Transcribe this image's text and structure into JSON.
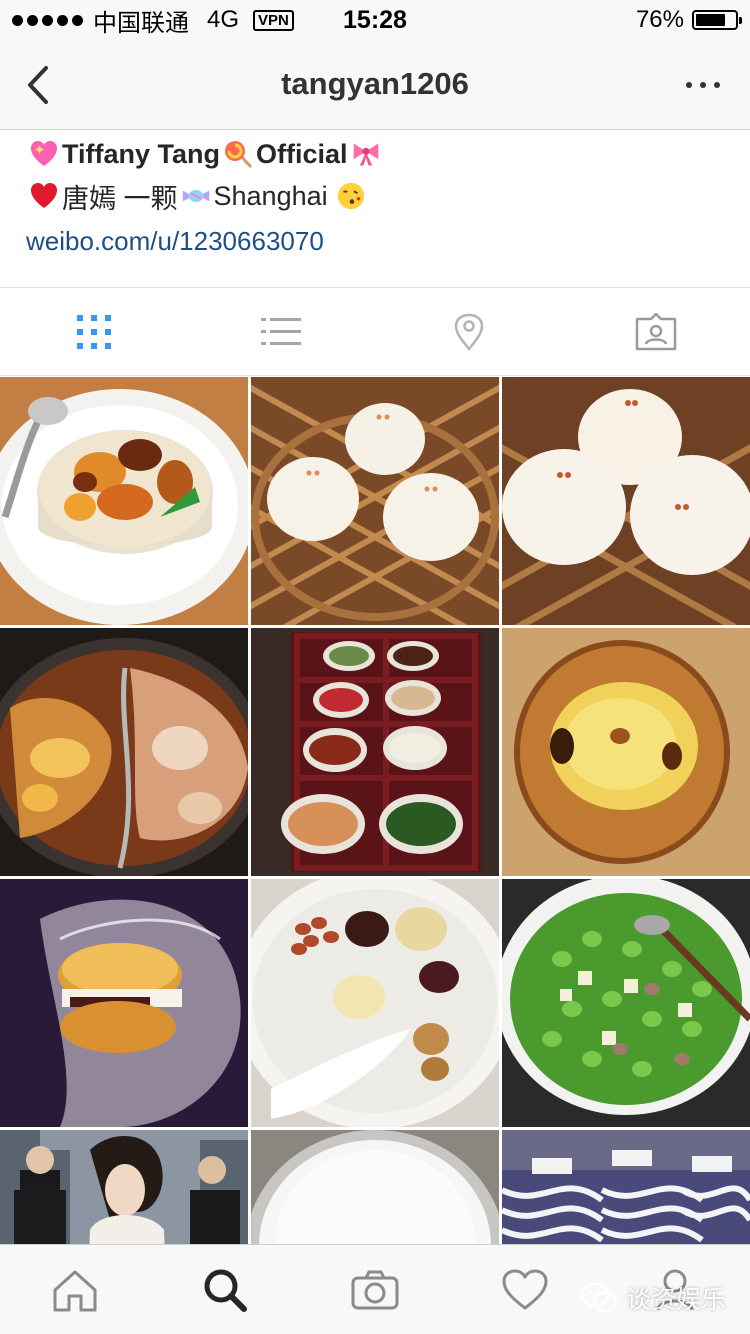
{
  "status_bar": {
    "carrier": "中国联通",
    "network": "4G",
    "vpn": "VPN",
    "time": "15:28",
    "battery_percent": "76%",
    "battery_level": 0.76
  },
  "nav": {
    "title": "tangyan1206",
    "back_icon": "chevron-left-icon",
    "more_icon": "more-dots-icon"
  },
  "bio": {
    "name": "Tiffany Tang",
    "official": "Official",
    "chinese_name": "唐嫣 一颗",
    "city": "Shanghai",
    "link": "weibo.com/u/1230663070"
  },
  "profile_tabs": [
    {
      "icon": "grid-icon",
      "active": true
    },
    {
      "icon": "list-icon",
      "active": false
    },
    {
      "icon": "location-pin-icon",
      "active": false
    },
    {
      "icon": "tagged-photos-icon",
      "active": false
    }
  ],
  "photos": [
    {
      "subject": "sticky-rice-dessert"
    },
    {
      "subject": "steamed-buns-basket"
    },
    {
      "subject": "steamed-buns-basket-closeup"
    },
    {
      "subject": "hot-pot"
    },
    {
      "subject": "sauce-tray"
    },
    {
      "subject": "egg-tart"
    },
    {
      "subject": "fried-bun-sandwich"
    },
    {
      "subject": "congee-with-toppings"
    },
    {
      "subject": "edamame-stir-fry"
    },
    {
      "subject": "movie-poster"
    },
    {
      "subject": "white-bowl"
    },
    {
      "subject": "zebra-pattern-items"
    }
  ],
  "tab_bar": [
    {
      "icon": "home-icon"
    },
    {
      "icon": "search-icon",
      "active": true
    },
    {
      "icon": "camera-icon"
    },
    {
      "icon": "heart-icon"
    },
    {
      "icon": "profile-icon"
    }
  ],
  "watermark": {
    "text": "谈资娱乐"
  },
  "colors": {
    "accent_blue": "#3897f0",
    "link_blue": "#1d4f86",
    "icon_gray": "#999999"
  }
}
